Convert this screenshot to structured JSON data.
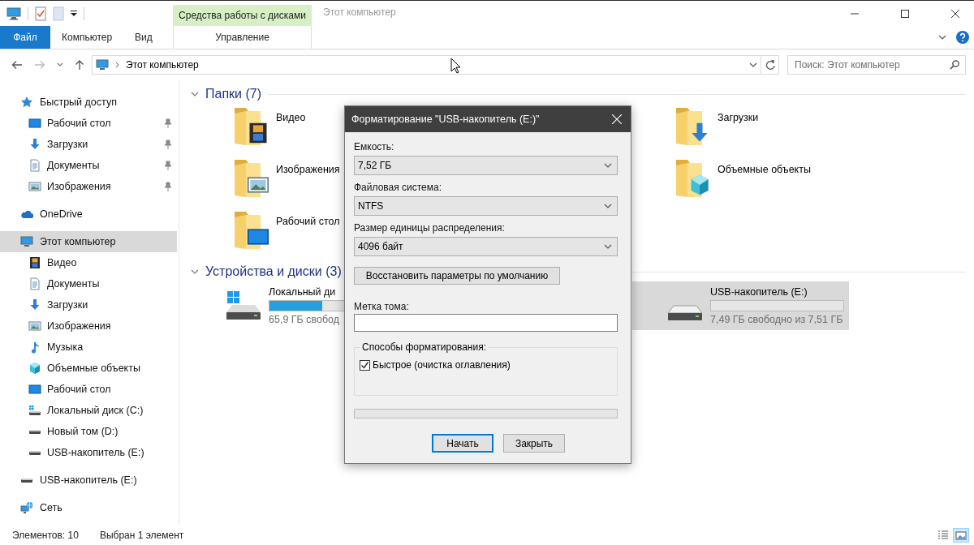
{
  "window": {
    "context_tab": "Средства работы с дисками",
    "title": "Этот компьютер"
  },
  "ribbon_tabs": [
    {
      "label": "Файл",
      "kind": "file"
    },
    {
      "label": "Компьютер",
      "kind": "tab"
    },
    {
      "label": "Вид",
      "kind": "tab"
    },
    {
      "label": "Управление",
      "kind": "context"
    }
  ],
  "address_bar": {
    "path": "Этот компьютер"
  },
  "search": {
    "placeholder": "Поиск: Этот компьютер"
  },
  "navigation": [
    {
      "label": "Быстрый доступ",
      "kind": "quick",
      "selected": false,
      "children": [
        {
          "label": "Рабочий стол",
          "kind": "desktop",
          "pinned": true,
          "selected": false
        },
        {
          "label": "Загрузки",
          "kind": "downloads",
          "pinned": true,
          "selected": false
        },
        {
          "label": "Документы",
          "kind": "documents",
          "pinned": true,
          "selected": false
        },
        {
          "label": "Изображения",
          "kind": "pictures",
          "pinned": true,
          "selected": false
        }
      ]
    },
    {
      "label": "OneDrive",
      "kind": "onedrive",
      "selected": false
    },
    {
      "label": "Этот компьютер",
      "kind": "computer",
      "selected": true,
      "children": [
        {
          "label": "Видео",
          "kind": "videos",
          "selected": false
        },
        {
          "label": "Документы",
          "kind": "documents",
          "selected": false
        },
        {
          "label": "Загрузки",
          "kind": "downloads",
          "selected": false
        },
        {
          "label": "Изображения",
          "kind": "pictures",
          "selected": false
        },
        {
          "label": "Музыка",
          "kind": "music",
          "selected": false
        },
        {
          "label": "Объемные объекты",
          "kind": "objects3d",
          "selected": false
        },
        {
          "label": "Рабочий стол",
          "kind": "desktop",
          "selected": false
        },
        {
          "label": "Локальный диск (C:)",
          "kind": "systemdrive",
          "selected": false
        },
        {
          "label": "Новый том (D:)",
          "kind": "drive",
          "selected": false
        },
        {
          "label": "USB-накопитель (E:)",
          "kind": "drive",
          "selected": false
        }
      ]
    },
    {
      "label": "USB-накопитель (E:)",
      "kind": "drive",
      "selected": false
    },
    {
      "label": "Сеть",
      "kind": "network",
      "selected": false
    }
  ],
  "folders": {
    "heading": "Папки (7)",
    "items": [
      {
        "name": "Видео",
        "kind": "videos"
      },
      {
        "name": "Загрузки",
        "kind": "downloads"
      },
      {
        "name": "Изображения",
        "kind": "pictures"
      },
      {
        "name": "Объемные объекты",
        "kind": "objects3d"
      },
      {
        "name": "Рабочий стол",
        "kind": "desktop"
      }
    ]
  },
  "devices": {
    "heading": "Устройства и диски (3)",
    "items": [
      {
        "name": "Локальный ди",
        "kind": "systemdrive",
        "level": 0.4,
        "free": "65,9 ГБ свобод",
        "selected": false
      },
      {
        "name": "USB-накопитель (E:)",
        "kind": "drive",
        "level": 0,
        "free": "7,49 ГБ свободно из 7,51 ГБ",
        "selected": true
      }
    ]
  },
  "status_bar": {
    "items": "Элементов: 10",
    "selection": "Выбран 1 элемент",
    "views": [
      {
        "kind": "details",
        "selected": false
      },
      {
        "kind": "tiles",
        "selected": true
      }
    ]
  },
  "dialog": {
    "title": "Форматирование \"USB-накопитель (E:)\"",
    "fields": [
      {
        "label": "Емкость:",
        "value": "7,52 ГБ"
      },
      {
        "label": "Файловая система:",
        "value": "NTFS"
      },
      {
        "label": "Размер единицы распределения:",
        "value": "4096 байт"
      }
    ],
    "restore_button": "Восстановить параметры по умолчанию",
    "volume_label": "Метка тома:",
    "options": {
      "legend": "Способы форматирования:",
      "checkboxes": [
        {
          "label": "Быстрое (очистка оглавления)",
          "checked": true
        }
      ]
    },
    "progress": {
      "level": 0
    },
    "buttons": [
      {
        "label": "Начать",
        "default": true
      },
      {
        "label": "Закрыть",
        "default": false
      }
    ]
  }
}
